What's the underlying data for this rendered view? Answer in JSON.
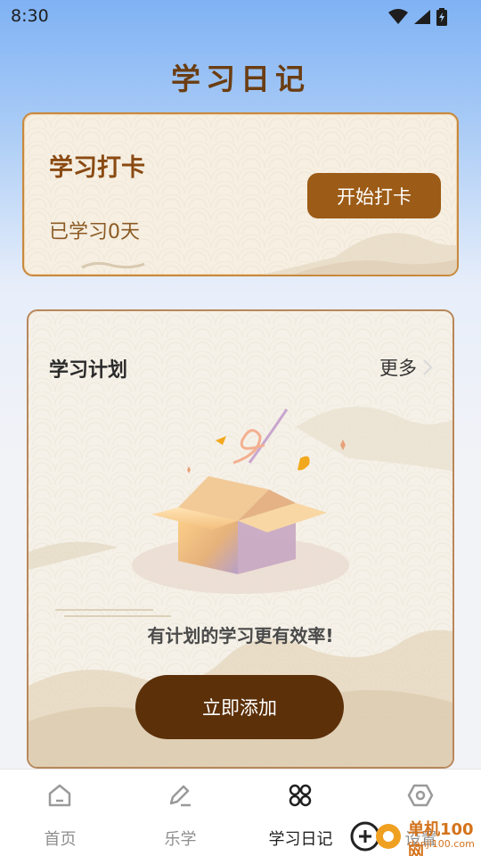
{
  "status_bar": {
    "time": "8:30"
  },
  "page": {
    "title": "学习日记"
  },
  "checkin": {
    "title": "学习打卡",
    "days_text": "已学习0天",
    "button_label": "开始打卡"
  },
  "plan": {
    "title": "学习计划",
    "more_label": "更多",
    "empty_text": "有计划的学习更有效率!",
    "add_button_label": "立即添加"
  },
  "nav": {
    "items": [
      {
        "label": "首页",
        "icon": "home-icon",
        "active": false
      },
      {
        "label": "乐学",
        "icon": "edit-icon",
        "active": false
      },
      {
        "label": "学习日记",
        "icon": "grid-icon",
        "active": true
      },
      {
        "label": "设置",
        "icon": "settings-icon",
        "active": false
      }
    ]
  },
  "watermark": {
    "line1": "单机100网",
    "line2": "danji100.com"
  },
  "colors": {
    "accent_brown": "#9c5b16",
    "dark_brown": "#5c3009",
    "title_brown": "#6b3d12"
  }
}
